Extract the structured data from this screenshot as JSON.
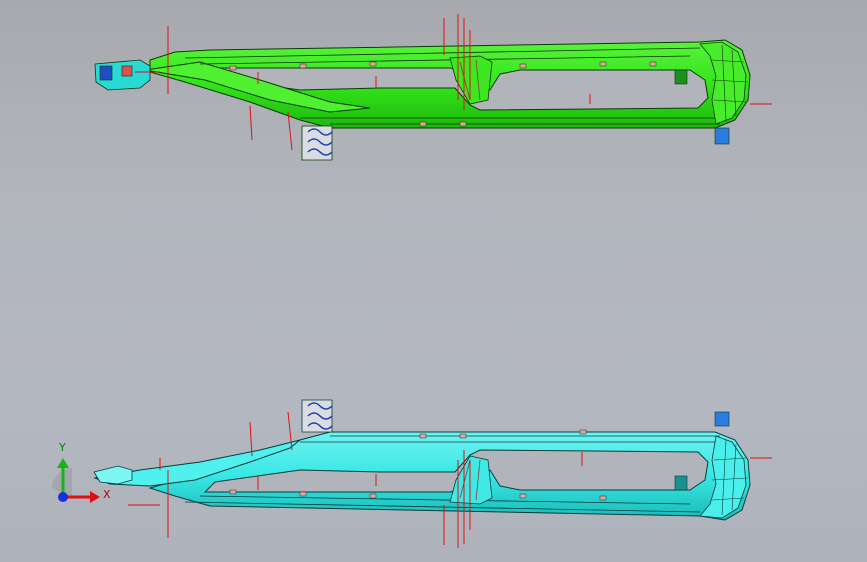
{
  "viewport": {
    "background_top": "#a7a9ae",
    "background_bottom": "#b4b8c2"
  },
  "parts": [
    {
      "name": "swingarm-top-view",
      "color": "#33e51a",
      "edge_color": "#0b3a06"
    },
    {
      "name": "swingarm-bottom-view",
      "color": "#38e7e4",
      "edge_color": "#063c3b"
    }
  ],
  "annotation_color": "#e01010",
  "triad": {
    "x_label": "X",
    "y_label": "Y",
    "x_color": "#e01010",
    "y_color": "#18b318",
    "z_color": "#1a2fd8"
  }
}
